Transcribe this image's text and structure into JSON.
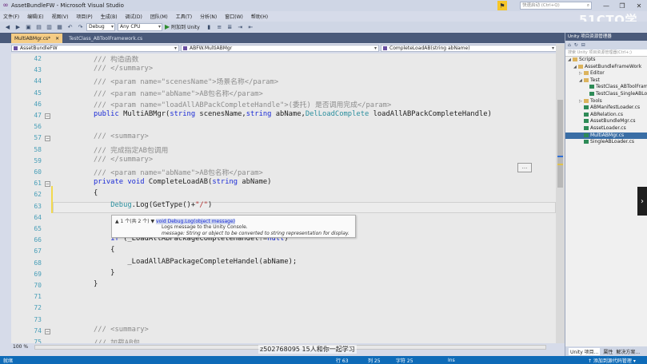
{
  "window": {
    "title": "AssetBundleFW - Microsoft Visual Studio",
    "quick_launch": "快速启动 (Ctrl+Q)",
    "watermark": "51CTO学院"
  },
  "menu": [
    "文件(F)",
    "编辑(E)",
    "视图(V)",
    "项目(P)",
    "生成(B)",
    "调试(D)",
    "团队(M)",
    "工具(T)",
    "分析(N)",
    "窗口(W)",
    "帮助(H)"
  ],
  "toolbar": {
    "config": "Debug",
    "platform": "Any CPU",
    "attach_label": "附加到 Unity"
  },
  "tabs": [
    {
      "label": "MultiABMgr.cs*",
      "active": true
    },
    {
      "label": "TestClass_ABToolFramework.cs",
      "active": false
    }
  ],
  "nav": {
    "project": "AssetBundleFW",
    "class": "ABFW.MultiABMgr",
    "member": "CompleteLoadAB(string abName)"
  },
  "code_lines": [
    {
      "n": "42",
      "html": "<span class='cmt'>/// 构造函数</span>"
    },
    {
      "n": "43",
      "html": "<span class='cmt'>/// &lt;/summary&gt;</span>"
    },
    {
      "n": "44",
      "html": "<span class='cmt'>/// &lt;param name=\"scenesName\"&gt;场景名称&lt;/param&gt;</span>"
    },
    {
      "n": "45",
      "html": "<span class='cmt'>/// &lt;param name=\"abName\"&gt;AB包名称&lt;/param&gt;</span>"
    },
    {
      "n": "46",
      "html": "<span class='cmt'>/// &lt;param name=\"loadAllABPackCompleteHandle\"&gt;(委托) 是否调用完成&lt;/param&gt;</span>"
    },
    {
      "n": "47",
      "html": "<span class='kw'>public</span> MultiABMgr(<span class='kw'>string</span> scenesName,<span class='kw'>string</span> abName,<span class='ty'>DelLoadComplete</span> loadAllABPackCompleteHandle)"
    },
    {
      "n": "56",
      "html": ""
    },
    {
      "n": "57",
      "html": "<span class='cmt'>/// &lt;summary&gt;</span>"
    },
    {
      "n": "58",
      "html": "<span class='cmt'>/// 完成指定AB包调用</span>"
    },
    {
      "n": "59",
      "html": "<span class='cmt'>/// &lt;/summary&gt;</span>"
    },
    {
      "n": "60",
      "html": "<span class='cmt'>/// &lt;param name=\"abName\"&gt;AB包名称&lt;/param&gt;</span>"
    },
    {
      "n": "61",
      "html": "<span class='kw'>private void</span> CompleteLoadAB(<span class='kw'>string</span> abName)"
    },
    {
      "n": "62",
      "html": "{"
    },
    {
      "n": "63",
      "html": "    <span class='ty'>Debug</span>.Log(GetType()+<span class='str'>\"/\"</span>)"
    },
    {
      "n": "64",
      "html": ""
    },
    {
      "n": "65",
      "html": ""
    },
    {
      "n": "66",
      "html": "    <span class='kw'>if</span> (_LoadAllABPackageCompleteHandel!=<span class='kw'>null</span>)"
    },
    {
      "n": "67",
      "html": "    {"
    },
    {
      "n": "68",
      "html": "        _LoadAllABPackageCompleteHandel(abName);"
    },
    {
      "n": "69",
      "html": "    }"
    },
    {
      "n": "70",
      "html": "}"
    },
    {
      "n": "71",
      "html": ""
    },
    {
      "n": "72",
      "html": ""
    },
    {
      "n": "73",
      "html": ""
    },
    {
      "n": "74",
      "html": "<span class='cmt'>/// &lt;summary&gt;</span>"
    },
    {
      "n": "75",
      "html": "<span class='cmt'>/// 加载AB包</span>"
    }
  ],
  "tooltip": {
    "counter": "▲ 1 个(共 2 个) ▼",
    "signature": "void Debug.Log(object message)",
    "desc": "Logs message to the Unity Console.",
    "param": "message: String or object to be converted to string representation for display."
  },
  "collapse_marker": "...",
  "zoom": "100 %",
  "caption": "z502768095 15人和你一起学习",
  "status": {
    "ready": "就绪",
    "line": "行 63",
    "col": "列 25",
    "ch": "字符 25",
    "mode": "Ins",
    "publish": "↑ 添加到源代码管理 ▾"
  },
  "solution": {
    "title": "Unity 项目资源管理器",
    "search": "搜索 Unity 项目资源管理器(Ctrl+;)",
    "tree": [
      {
        "label": "Scripts",
        "level": 0,
        "arrow": "◢"
      },
      {
        "label": "AssetBundleFrameWork",
        "level": 1,
        "arrow": "◢"
      },
      {
        "label": "Editor",
        "level": 2,
        "arrow": "▷"
      },
      {
        "label": "Test",
        "level": 2,
        "arrow": "◢"
      },
      {
        "label": "TestClass_ABToolFramework.cs",
        "level": 3,
        "arrow": ""
      },
      {
        "label": "TestClass_SingleABLoader.cs",
        "level": 3,
        "arrow": ""
      },
      {
        "label": "Tools",
        "level": 2,
        "arrow": "▷"
      },
      {
        "label": "ABManifestLoader.cs",
        "level": 2,
        "arrow": ""
      },
      {
        "label": "ABRelation.cs",
        "level": 2,
        "arrow": ""
      },
      {
        "label": "AssetBundleMgr.cs",
        "level": 2,
        "arrow": ""
      },
      {
        "label": "AssetLoader.cs",
        "level": 2,
        "arrow": ""
      },
      {
        "label": "MultiABMgr.cs",
        "level": 2,
        "arrow": "",
        "selected": true
      },
      {
        "label": "SingleABLoader.cs",
        "level": 2,
        "arrow": ""
      }
    ],
    "bottom_tabs": [
      "Unity 项目...",
      "属性",
      "解决方案..."
    ]
  }
}
